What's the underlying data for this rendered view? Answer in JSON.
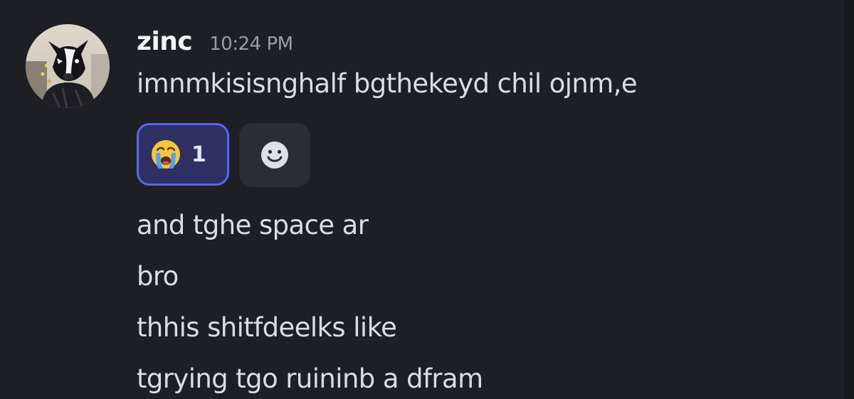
{
  "message": {
    "author": "zinc",
    "timestamp": "10:24 PM",
    "lines": [
      "imnmkisisnghalf bgthekeyd chil ojnm,e"
    ],
    "reactions": [
      {
        "emoji": "loudly-crying-face",
        "count": "1",
        "selected": true
      }
    ],
    "add_reaction_icon": "smiley-face-icon"
  },
  "followups": [
    "and tghe space ar",
    "bro",
    "thhis shitfdeelks like",
    "tgrying tgo ruininb a dfram"
  ],
  "colors": {
    "background": "#1e1f24",
    "text": "#dcdde2",
    "username": "#f2f3f5",
    "timestamp": "#9a9ca6",
    "reaction_border": "#5865f2",
    "reaction_bg": "#2d3061",
    "add_reaction_bg": "#2c2d34"
  }
}
